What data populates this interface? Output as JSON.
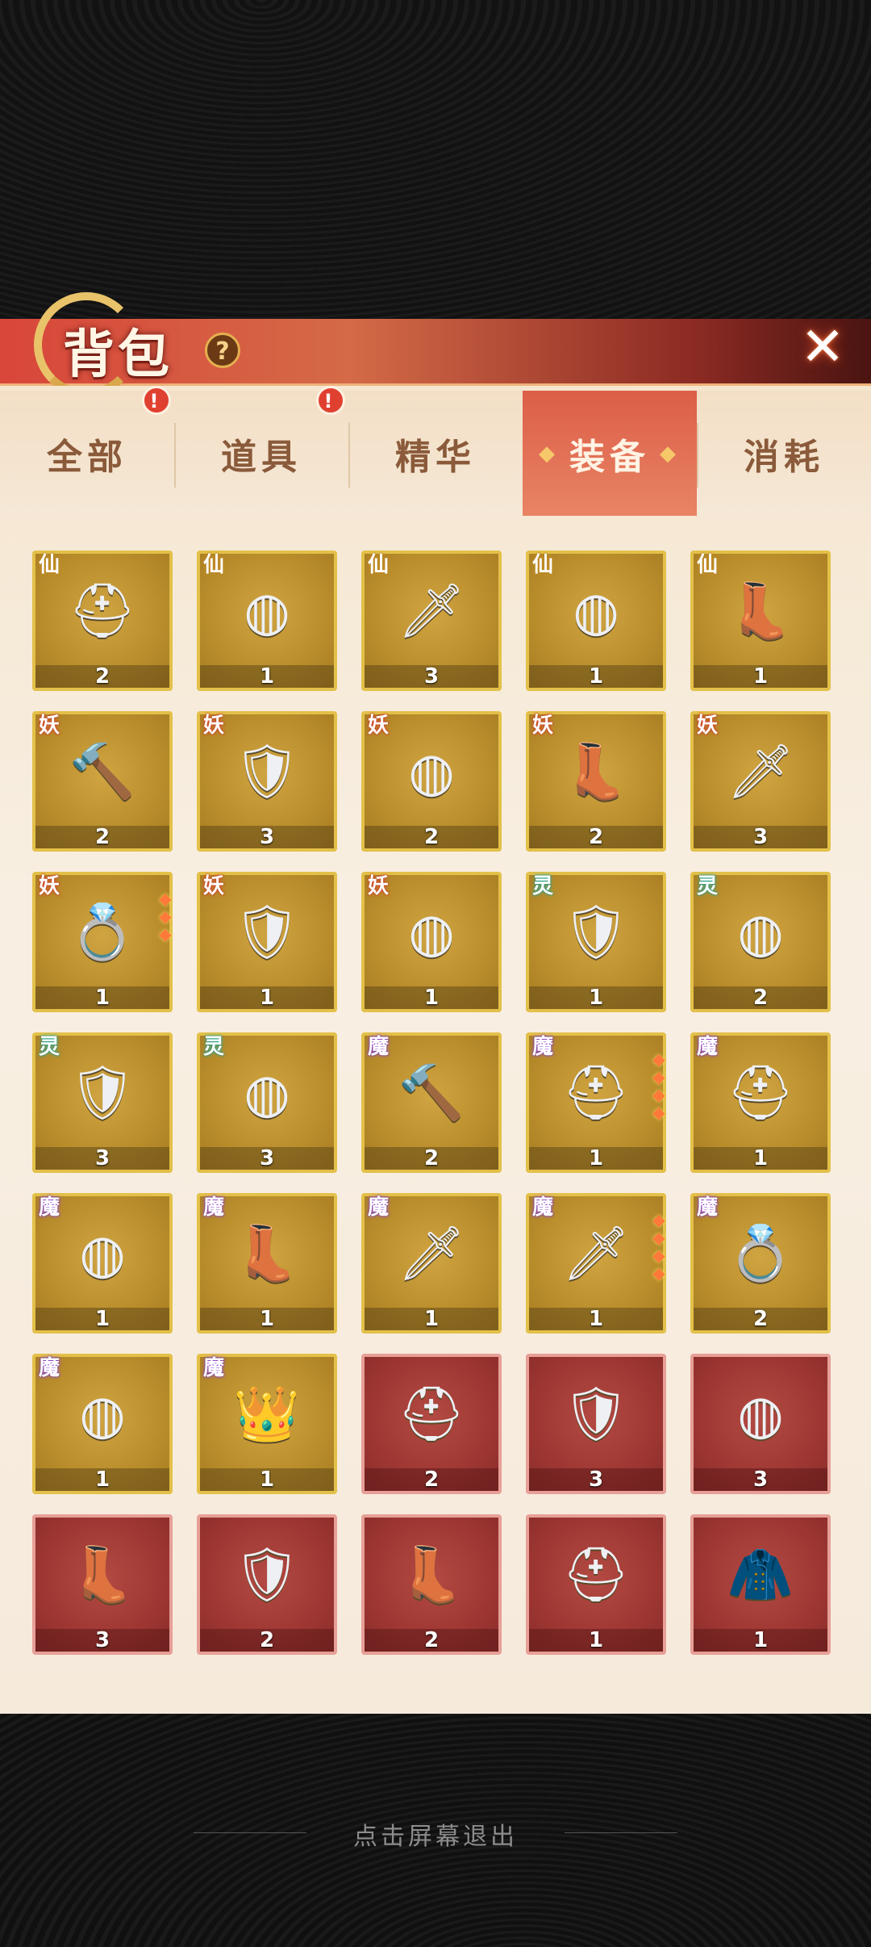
{
  "header": {
    "title": "背包",
    "help_icon": "?",
    "close_icon": "✕"
  },
  "tabs": [
    {
      "label": "全部",
      "badge": "!",
      "active": false
    },
    {
      "label": "道具",
      "badge": "!",
      "active": false
    },
    {
      "label": "精华",
      "badge": "",
      "active": false
    },
    {
      "label": "装备",
      "badge": "",
      "active": true
    },
    {
      "label": "消耗",
      "badge": "",
      "active": false
    }
  ],
  "items": [
    {
      "faction": "仙",
      "icon": "⛑",
      "count": "2",
      "frame": "gold",
      "stars": 0
    },
    {
      "faction": "仙",
      "icon": "◍",
      "count": "1",
      "frame": "gold",
      "stars": 0
    },
    {
      "faction": "仙",
      "icon": "🗡",
      "count": "3",
      "frame": "gold",
      "stars": 0
    },
    {
      "faction": "仙",
      "icon": "◍",
      "count": "1",
      "frame": "gold",
      "stars": 0
    },
    {
      "faction": "仙",
      "icon": "👢",
      "count": "1",
      "frame": "gold",
      "stars": 0
    },
    {
      "faction": "妖",
      "icon": "🔨",
      "count": "2",
      "frame": "gold",
      "stars": 0
    },
    {
      "faction": "妖",
      "icon": "🛡",
      "count": "3",
      "frame": "gold",
      "stars": 0
    },
    {
      "faction": "妖",
      "icon": "◍",
      "count": "2",
      "frame": "gold",
      "stars": 0
    },
    {
      "faction": "妖",
      "icon": "👢",
      "count": "2",
      "frame": "gold",
      "stars": 0
    },
    {
      "faction": "妖",
      "icon": "🗡",
      "count": "3",
      "frame": "gold",
      "stars": 0
    },
    {
      "faction": "妖",
      "icon": "💍",
      "count": "1",
      "frame": "gold",
      "stars": 3
    },
    {
      "faction": "妖",
      "icon": "🛡",
      "count": "1",
      "frame": "gold",
      "stars": 0
    },
    {
      "faction": "妖",
      "icon": "◍",
      "count": "1",
      "frame": "gold",
      "stars": 0
    },
    {
      "faction": "灵",
      "icon": "🛡",
      "count": "1",
      "frame": "gold",
      "stars": 0
    },
    {
      "faction": "灵",
      "icon": "◍",
      "count": "2",
      "frame": "gold",
      "stars": 0
    },
    {
      "faction": "灵",
      "icon": "🛡",
      "count": "3",
      "frame": "gold",
      "stars": 0
    },
    {
      "faction": "灵",
      "icon": "◍",
      "count": "3",
      "frame": "gold",
      "stars": 0
    },
    {
      "faction": "魔",
      "icon": "🔨",
      "count": "2",
      "frame": "gold",
      "stars": 0
    },
    {
      "faction": "魔",
      "icon": "⛑",
      "count": "1",
      "frame": "gold",
      "stars": 4
    },
    {
      "faction": "魔",
      "icon": "⛑",
      "count": "1",
      "frame": "gold",
      "stars": 0
    },
    {
      "faction": "魔",
      "icon": "◍",
      "count": "1",
      "frame": "gold",
      "stars": 0
    },
    {
      "faction": "魔",
      "icon": "👢",
      "count": "1",
      "frame": "gold",
      "stars": 0
    },
    {
      "faction": "魔",
      "icon": "🗡",
      "count": "1",
      "frame": "gold",
      "stars": 0
    },
    {
      "faction": "魔",
      "icon": "🗡",
      "count": "1",
      "frame": "gold",
      "stars": 4
    },
    {
      "faction": "魔",
      "icon": "💍",
      "count": "2",
      "frame": "gold",
      "stars": 0
    },
    {
      "faction": "魔",
      "icon": "◍",
      "count": "1",
      "frame": "gold",
      "stars": 0
    },
    {
      "faction": "魔",
      "icon": "👑",
      "count": "1",
      "frame": "gold",
      "stars": 0
    },
    {
      "faction": "",
      "icon": "⛑",
      "count": "2",
      "frame": "red",
      "stars": 0
    },
    {
      "faction": "",
      "icon": "🛡",
      "count": "3",
      "frame": "red",
      "stars": 0
    },
    {
      "faction": "",
      "icon": "◍",
      "count": "3",
      "frame": "red",
      "stars": 0
    },
    {
      "faction": "",
      "icon": "👢",
      "count": "3",
      "frame": "red",
      "stars": 0
    },
    {
      "faction": "",
      "icon": "🛡",
      "count": "2",
      "frame": "red",
      "stars": 0
    },
    {
      "faction": "",
      "icon": "👢",
      "count": "2",
      "frame": "red",
      "stars": 0
    },
    {
      "faction": "",
      "icon": "⛑",
      "count": "1",
      "frame": "red",
      "stars": 0
    },
    {
      "faction": "",
      "icon": "🧥",
      "count": "1",
      "frame": "red",
      "stars": 0
    }
  ],
  "footer": {
    "exit_hint": "点击屏幕退出"
  },
  "colors": {
    "accent": "#dc5e48",
    "gold_frame": "#e3c049",
    "red_frame": "#e79f97"
  }
}
